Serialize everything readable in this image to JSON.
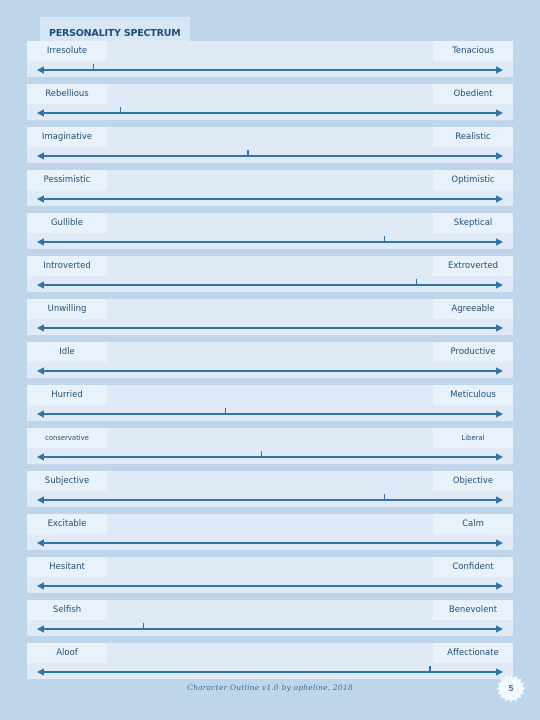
{
  "page": {
    "title": "PERSONALITY SPECTRUM",
    "background_color": "#bfd6ea",
    "row_color": "#dfeaf6",
    "label_color": "#e9f2fa",
    "accent_color": "#2e74a8",
    "text_color": "#1f4e79"
  },
  "footer": {
    "credit": "Character Outline v1.0 by opheline, 2018",
    "page_number": "5"
  },
  "chart_data": {
    "type": "bar",
    "title": "PERSONALITY SPECTRUM",
    "xlabel": "",
    "ylabel": "",
    "xlim": [
      0,
      100
    ],
    "grid": false,
    "legend": "none",
    "note": "Each row is a bipolar slider; value is the tick position as percent from the left pole (null = no tick marked).",
    "categories": [
      "Irresolute – Tenacious",
      "Rebellious – Obedient",
      "Imaginative – Realistic",
      "Pessimistic – Optimistic",
      "Gullible – Skeptical",
      "Introverted – Extroverted",
      "Unwilling – Agreeable",
      "Idle – Productive",
      "Hurried – Meticulous",
      "conservative – Liberal",
      "Subjective – Objective",
      "Excitable – Calm",
      "Hesitant – Confident",
      "Selfish – Benevolent",
      "Aloof – Affectionate"
    ],
    "values": [
      11,
      17,
      45,
      null,
      75,
      82,
      null,
      null,
      40,
      48,
      75,
      null,
      null,
      22,
      85
    ]
  },
  "rows": [
    {
      "left": "Irresolute",
      "right": "Tenacious",
      "tick": 11,
      "small": false
    },
    {
      "left": "Rebellious",
      "right": "Obedient",
      "tick": 17,
      "small": false
    },
    {
      "left": "Imaginative",
      "right": "Realistic",
      "tick": 45,
      "small": false
    },
    {
      "left": "Pessimistic",
      "right": "Optimistic",
      "tick": null,
      "small": false
    },
    {
      "left": "Gullible",
      "right": "Skeptical",
      "tick": 75,
      "small": false
    },
    {
      "left": "Introverted",
      "right": "Extroverted",
      "tick": 82,
      "small": false
    },
    {
      "left": "Unwilling",
      "right": "Agreeable",
      "tick": null,
      "small": false
    },
    {
      "left": "Idle",
      "right": "Productive",
      "tick": null,
      "small": false
    },
    {
      "left": "Hurried",
      "right": "Meticulous",
      "tick": 40,
      "small": false
    },
    {
      "left": "conservative",
      "right": "Liberal",
      "tick": 48,
      "small": true
    },
    {
      "left": "Subjective",
      "right": "Objective",
      "tick": 75,
      "small": false
    },
    {
      "left": "Excitable",
      "right": "Calm",
      "tick": null,
      "small": false
    },
    {
      "left": "Hesitant",
      "right": "Confident",
      "tick": null,
      "small": false
    },
    {
      "left": "Selfish",
      "right": "Benevolent",
      "tick": 22,
      "small": false
    },
    {
      "left": "Aloof",
      "right": "Affectionate",
      "tick": 85,
      "small": false
    }
  ]
}
